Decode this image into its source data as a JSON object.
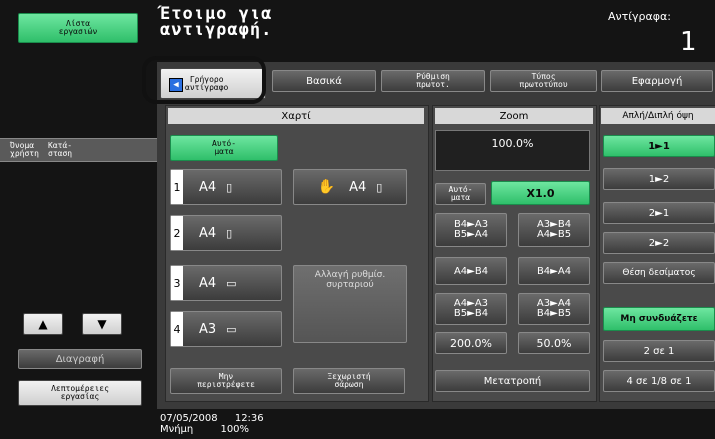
{
  "header": {
    "job_list_btn": "Λίστα\nεργασιών",
    "status_line1": "Έτοιμο για",
    "status_line2": "αντιγραφή.",
    "copies_label": "Αντίγραφα:",
    "copies_value": "1"
  },
  "tabs": [
    {
      "label": "Γρήγορο\nαντίγραφο"
    },
    {
      "label": "Βασικά"
    },
    {
      "label": "Ρύθμιση\nπρωτοτ."
    },
    {
      "label": "Τύπος\nπρωτοτύπου"
    },
    {
      "label": "Εφαρμογή"
    }
  ],
  "left": {
    "user_name": "Όνομα\nχρήστη",
    "status": "Κατά-\nσταση",
    "delete_btn": "Διαγραφή",
    "job_details_btn": "Λεπτομέρειες\nεργασίας"
  },
  "paper": {
    "header": "Χαρτί",
    "auto_btn": "Αυτό-\nματα",
    "trays": [
      {
        "num": "1",
        "size": "A4"
      },
      {
        "num": "2",
        "size": "A4"
      },
      {
        "num": "3",
        "size": "A4"
      },
      {
        "num": "4",
        "size": "A3"
      }
    ],
    "bypass_size": "A4",
    "change_tray_btn": "Αλλαγή ρυθμίσ.\nσυρταριού",
    "no_rotate_btn": "Μην\nπεριστρέφετε",
    "separate_scan_btn": "Ξεχωριστή\nσάρωση"
  },
  "zoom": {
    "header": "Zoom",
    "value": "100.0%",
    "auto_btn": "Αυτό-\nματα",
    "x1_btn": "X1.0",
    "presets": [
      "B4►A3\nB5►A4",
      "A3►B4\nA4►B5",
      "A4►B4",
      "B4►A4",
      "A4►A3\nB5►B4",
      "A3►A4\nB4►B5",
      "200.0%",
      "50.0%"
    ],
    "convert_btn": "Μετατροπή"
  },
  "duplex": {
    "header": "Απλή/Διπλή όψη",
    "options": [
      "1►1",
      "1►2",
      "2►1",
      "2►2"
    ],
    "binding_pos_btn": "Θέση δεσίματος",
    "combine_header": "Μη συνδυάζετε",
    "combine_2in1": "2 σε 1",
    "combine_4in1": "4 σε 1/8 σε 1"
  },
  "footer": {
    "date": "07/05/2008",
    "time": "12:36",
    "memory_label": "Μνήμη",
    "memory_value": "100%"
  }
}
